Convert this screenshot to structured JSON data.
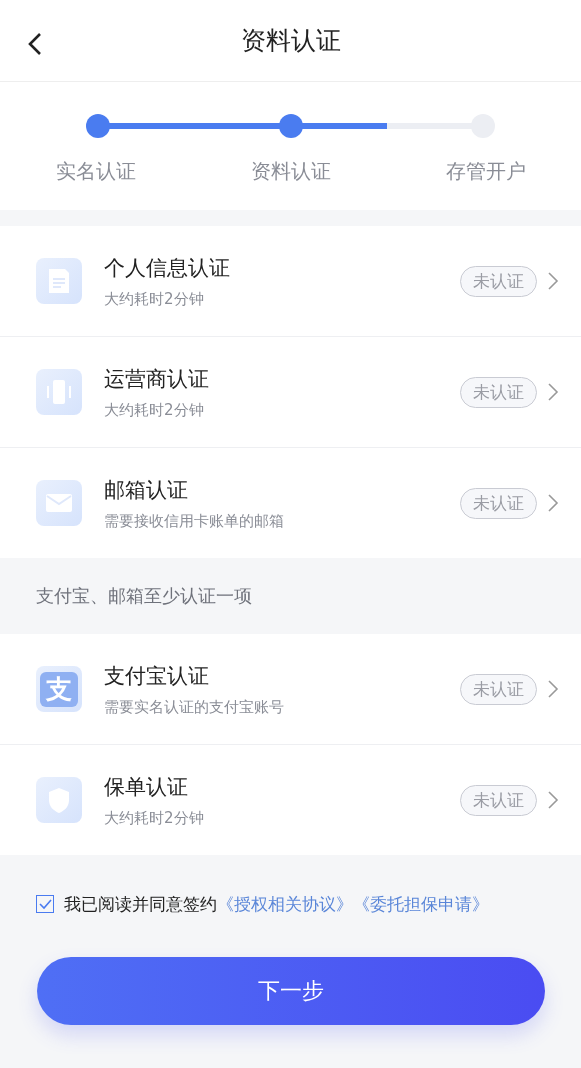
{
  "header": {
    "title": "资料认证"
  },
  "progress": {
    "level": 0.75,
    "steps": [
      {
        "label": "实名认证",
        "done": true
      },
      {
        "label": "资料认证",
        "done": true
      },
      {
        "label": "存管开户",
        "done": false
      }
    ]
  },
  "groups": [
    {
      "items": [
        {
          "kind": "document",
          "title": "个人信息认证",
          "subtitle": "大约耗时2分钟",
          "status": "未认证",
          "verified": false
        },
        {
          "kind": "phone",
          "title": "运营商认证",
          "subtitle": "大约耗时2分钟",
          "status": "未认证",
          "verified": false
        },
        {
          "kind": "mail",
          "title": "邮箱认证",
          "subtitle": "需要接收信用卡账单的邮箱",
          "status": "未认证",
          "verified": false
        }
      ]
    },
    {
      "note": "支付宝、邮箱至少认证一项",
      "items": [
        {
          "kind": "glyph",
          "glyph": "支",
          "title": "支付宝认证",
          "subtitle": "需要实名认证的支付宝账号",
          "status": "未认证",
          "verified": false
        },
        {
          "kind": "shield",
          "title": "保单认证",
          "subtitle": "大约耗时2分钟",
          "status": "未认证",
          "verified": false
        }
      ]
    }
  ],
  "agreement": {
    "checked": true,
    "text": "我已阅读并同意签约",
    "links": [
      "《授权相关协议》",
      "《委托担保申请》"
    ]
  },
  "next_button": "下一步"
}
